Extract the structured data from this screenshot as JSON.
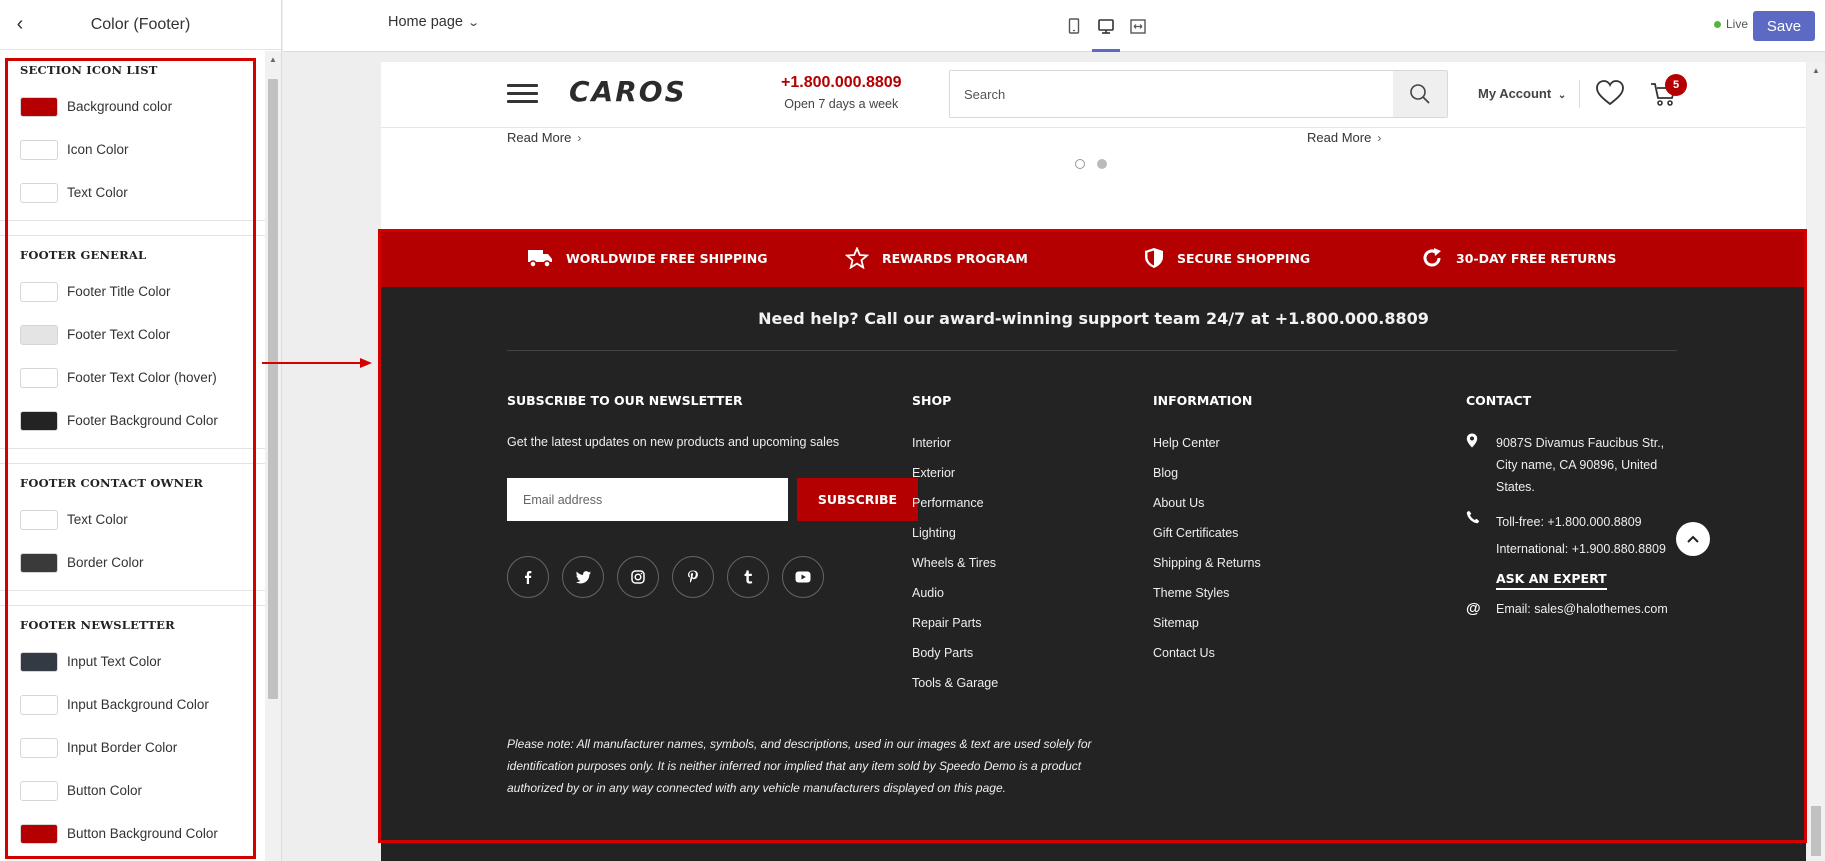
{
  "sidebar": {
    "back_label": "‹",
    "title": "Color (Footer)",
    "sections": [
      {
        "title": "SECTION ICON LIST",
        "items": [
          {
            "label": "Background color",
            "color": "#b40000"
          },
          {
            "label": "Icon Color",
            "color": "#ffffff"
          },
          {
            "label": "Text Color",
            "color": "#ffffff"
          }
        ]
      },
      {
        "title": "FOOTER GENERAL",
        "items": [
          {
            "label": "Footer Title Color",
            "color": "#ffffff"
          },
          {
            "label": "Footer Text Color",
            "color": "#e4e4e4"
          },
          {
            "label": "Footer Text Color (hover)",
            "color": "#ffffff"
          },
          {
            "label": "Footer Background Color",
            "color": "#232323"
          }
        ]
      },
      {
        "title": "FOOTER CONTACT OWNER",
        "items": [
          {
            "label": "Text Color",
            "color": "#ffffff"
          },
          {
            "label": "Border Color",
            "color": "#3a3a3a"
          }
        ]
      },
      {
        "title": "FOOTER NEWSLETTER",
        "items": [
          {
            "label": "Input Text Color",
            "color": "#333a44"
          },
          {
            "label": "Input Background Color",
            "color": "#ffffff"
          },
          {
            "label": "Input Border Color",
            "color": "#ffffff"
          },
          {
            "label": "Button Color",
            "color": "#ffffff"
          },
          {
            "label": "Button Background Color",
            "color": "#b40000"
          }
        ]
      }
    ]
  },
  "toolbar": {
    "page_select": "Home page",
    "live_label": "Live",
    "save_label": "Save",
    "accent": "#5c6ac4"
  },
  "store": {
    "logo": "CAROS",
    "phone": "+1.800.000.8809",
    "phone_sub": "Open 7 days a week",
    "search_placeholder": "Search",
    "account": "My Account",
    "cart_count": "5",
    "read_more_1": "Read More",
    "read_more_2": "Read More",
    "brand_color": "#b40000"
  },
  "footer": {
    "icon_list": [
      {
        "icon": "truck-icon",
        "label": "WORLDWIDE FREE SHIPPING"
      },
      {
        "icon": "star-icon",
        "label": "REWARDS PROGRAM"
      },
      {
        "icon": "shield-icon",
        "label": "SECURE SHOPPING"
      },
      {
        "icon": "refresh-icon",
        "label": "30-DAY FREE RETURNS"
      }
    ],
    "help_text": "Need help? Call our award-winning support team 24/7 at +1.800.000.8809",
    "newsletter": {
      "title": "SUBSCRIBE TO OUR NEWSLETTER",
      "description": "Get the latest updates on new products and upcoming sales",
      "placeholder": "Email address",
      "button": "SUBSCRIBE",
      "socials": [
        "facebook-icon",
        "twitter-icon",
        "instagram-icon",
        "pinterest-icon",
        "tumblr-icon",
        "youtube-icon"
      ]
    },
    "shop": {
      "title": "SHOP",
      "links": [
        "Interior",
        "Exterior",
        "Performance",
        "Lighting",
        "Wheels & Tires",
        "Audio",
        "Repair Parts",
        "Body Parts",
        "Tools & Garage"
      ]
    },
    "information": {
      "title": "INFORMATION",
      "links": [
        "Help Center",
        "Blog",
        "About Us",
        "Gift Certificates",
        "Shipping & Returns",
        "Theme Styles",
        "Sitemap",
        "Contact Us"
      ]
    },
    "contact": {
      "title": "CONTACT",
      "address_1": "9087S Divamus Faucibus Str.,",
      "address_2": "City name, CA 90896, United",
      "address_3": "States.",
      "tollfree": "Toll-free: +1.800.000.8809",
      "international": "International: +1.900.880.8809",
      "ask_expert": "ASK AN EXPERT",
      "email": "Email: sales@halothemes.com"
    },
    "disclaimer": "Please note: All manufacturer names, symbols, and descriptions, used in our images & text are used solely for identification purposes only. It is neither inferred nor implied that any item sold by Speedo Demo is a product authorized by or in any way connected with any vehicle manufacturers displayed on this page."
  }
}
